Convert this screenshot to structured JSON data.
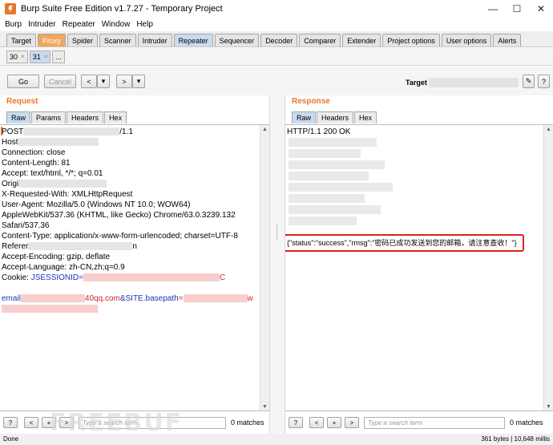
{
  "window": {
    "title": "Burp Suite Free Edition v1.7.27 - Temporary Project",
    "minimize": "—",
    "maximize": "☐",
    "close": "✕"
  },
  "menu": [
    "Burp",
    "Intruder",
    "Repeater",
    "Window",
    "Help"
  ],
  "main_tabs": [
    "Target",
    "Proxy",
    "Spider",
    "Scanner",
    "Intruder",
    "Repeater",
    "Sequencer",
    "Decoder",
    "Comparer",
    "Extender",
    "Project options",
    "User options",
    "Alerts"
  ],
  "active_main_tab": "Repeater",
  "sub_tabs": [
    {
      "label": "30",
      "close": "×"
    },
    {
      "label": "31",
      "close": "×"
    },
    {
      "label": "..."
    }
  ],
  "toolbar": {
    "go": "Go",
    "cancel": "Cancel",
    "back": "<",
    "back_menu": "▾",
    "forward": ">",
    "forward_menu": "▾",
    "target_label": "Target",
    "edit_icon": "✎",
    "help": "?"
  },
  "request": {
    "title": "Request",
    "tabs": [
      "Raw",
      "Params",
      "Headers",
      "Hex"
    ],
    "lines": {
      "l1": "POST",
      "l1_end": "/1.1",
      "l2": "Host",
      "l3": "Connection: close",
      "l4": "Content-Length: 81",
      "l5": "Accept: text/html, */*; q=0.01",
      "l6": "Origi",
      "l7": "X-Requested-With: XMLHttpRequest",
      "l8": "User-Agent: Mozilla/5.0 (Windows NT 10.0; WOW64)",
      "l9": "AppleWebKit/537.36 (KHTML, like Gecko) Chrome/63.0.3239.132",
      "l10": "Safari/537.36",
      "l11": "Content-Type: application/x-www-form-urlencoded; charset=UTF-8",
      "l12": "Referer",
      "l12_end": "n",
      "l13": "Accept-Encoding: gzip, deflate",
      "l14": "Accept-Language: zh-CN,zh;q=0.9",
      "l15_key": "Cookie: ",
      "l15_val": "JSESSIONID=",
      "l15_end": "C",
      "l17_a": "email",
      "l17_b": "40qq.com",
      "l17_c": "&SITE.basepath",
      "l17_d": "=",
      "l17_end": "w"
    },
    "search_placeholder": "Type a search term",
    "matches": "0 matches"
  },
  "response": {
    "title": "Response",
    "tabs": [
      "Raw",
      "Headers",
      "Hex"
    ],
    "status_line": "HTTP/1.1 200 OK",
    "json_line": "{\"status\":\"success\",\"rmsg\":\"密码已成功发送到您的邮箱，请注意查收！\"}",
    "search_placeholder": "Type a search term",
    "matches": "0 matches"
  },
  "search_buttons": {
    "help": "?",
    "prev": "<",
    "add": "+",
    "next": ">"
  },
  "status": {
    "left": "Done",
    "right": "361 bytes | 10,648 millis"
  },
  "watermark": "FREEBUF"
}
